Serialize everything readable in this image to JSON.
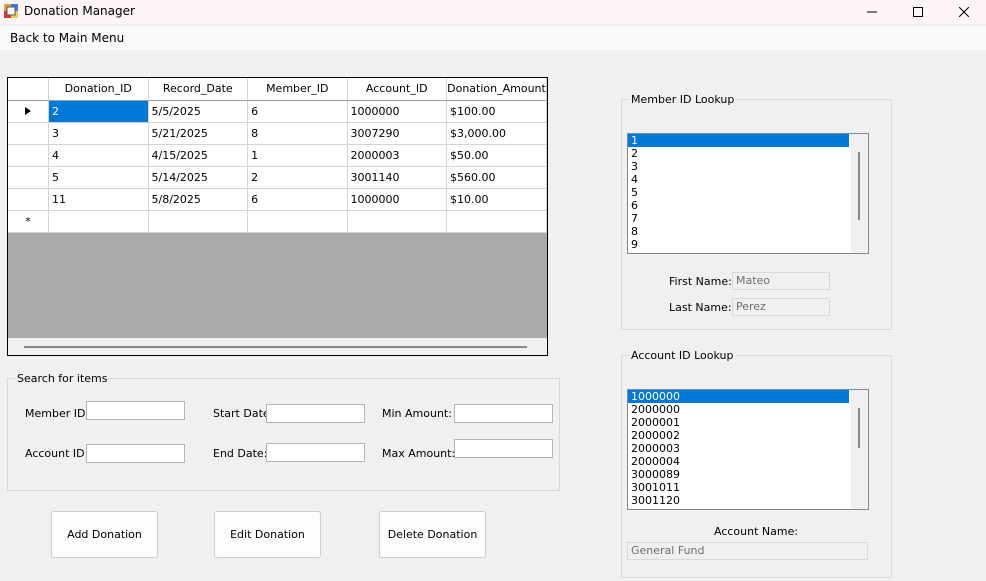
{
  "window": {
    "title": "Donation Manager"
  },
  "menu": {
    "back_label": "Back to Main Menu"
  },
  "grid": {
    "columns": [
      "Donation_ID",
      "Record_Date",
      "Member_ID",
      "Account_ID",
      "Donation_Amount"
    ],
    "rows": [
      [
        "2",
        "5/5/2025",
        "6",
        "1000000",
        "$100.00"
      ],
      [
        "3",
        "5/21/2025",
        "8",
        "3007290",
        "$3,000.00"
      ],
      [
        "4",
        "4/15/2025",
        "1",
        "2000003",
        "$50.00"
      ],
      [
        "5",
        "5/14/2025",
        "2",
        "3001140",
        "$560.00"
      ],
      [
        "11",
        "5/8/2025",
        "6",
        "1000000",
        "$10.00"
      ]
    ],
    "new_row_marker": "*"
  },
  "search": {
    "title": "Search for items",
    "member_id_label": "Member ID:",
    "account_id_label": "Account ID:",
    "start_date_label": "Start Date:",
    "end_date_label": "End Date:",
    "min_amount_label": "Min Amount:",
    "max_amount_label": "Max Amount:"
  },
  "buttons": {
    "add": "Add Donation",
    "edit": "Edit Donation",
    "delete": "Delete Donation"
  },
  "member_lookup": {
    "title": "Member ID Lookup",
    "items": [
      "1",
      "2",
      "3",
      "4",
      "5",
      "6",
      "7",
      "8",
      "9"
    ],
    "first_name_label": "First Name:",
    "first_name_value": "Mateo",
    "last_name_label": "Last Name:",
    "last_name_value": "Perez"
  },
  "account_lookup": {
    "title": "Account ID Lookup",
    "items": [
      "1000000",
      "2000000",
      "2000001",
      "2000002",
      "2000003",
      "2000004",
      "3000089",
      "3001011",
      "3001120"
    ],
    "account_name_label": "Account Name:",
    "account_name_value": "General Fund"
  },
  "colors": {
    "selection": "#0078d7"
  }
}
